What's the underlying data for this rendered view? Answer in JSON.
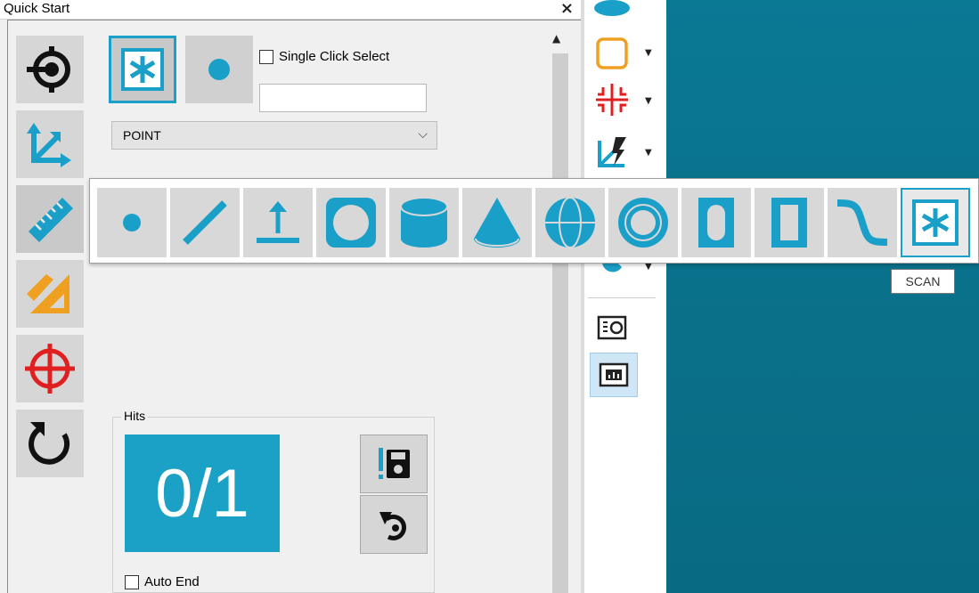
{
  "panel": {
    "title": "Quick Start",
    "close_label": "×",
    "single_click_label": "Single Click Select",
    "feature_input_value": "",
    "feature_type": "POINT",
    "hits_label": "Hits",
    "hits_value": "0/1",
    "auto_end_label": "Auto End"
  },
  "left_icons": [
    "probe-icon",
    "alignment-icon",
    "measure-icon",
    "construct-icon",
    "crosshair-icon",
    "reset-icon"
  ],
  "flyout": {
    "items": [
      "point",
      "line",
      "plane",
      "circle",
      "cylinder",
      "cone",
      "sphere",
      "torus",
      "slot",
      "rectangle",
      "curve",
      "scan"
    ],
    "tooltip": "SCAN"
  },
  "colors": {
    "accent": "#1aa0c8",
    "hits_bg": "#1ba1c5",
    "orange": "#f0a020",
    "red": "#e02020",
    "viewport": "#0a7994"
  }
}
